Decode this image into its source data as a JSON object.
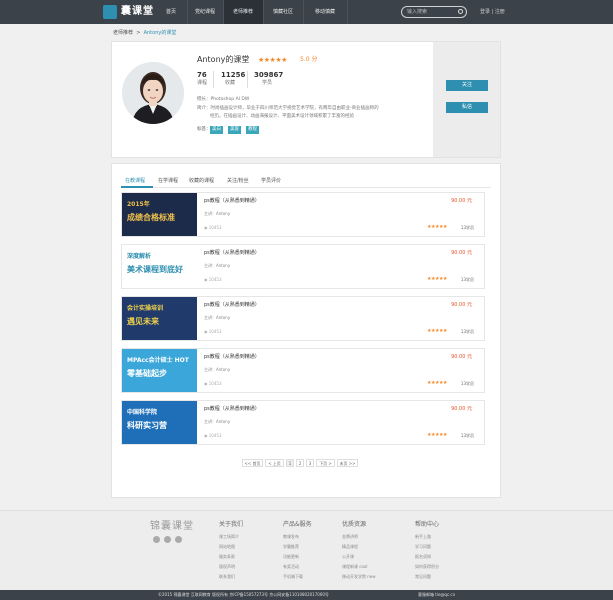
{
  "nav": {
    "logo": "囊课堂",
    "items": [
      "首页",
      "党纪课程",
      "老师推荐",
      "慎藏社区",
      "移动慎藏"
    ],
    "active_index": 2,
    "search_placeholder": "输入搜索",
    "login": "登录",
    "register": "注册"
  },
  "breadcrumb": {
    "root": "老师推荐",
    "sep": ">",
    "current": "Antony的课堂"
  },
  "profile": {
    "name": "Antony的课堂",
    "stars": "★★★★★",
    "score": "5.0 分",
    "stats": [
      {
        "value": "76",
        "label": "课程"
      },
      {
        "value": "11256",
        "label": "收藏"
      },
      {
        "value": "309867",
        "label": "学员"
      }
    ],
    "skills": "擅长：Photoshop   AI  DW",
    "intro1": "简介：时尚插画设计师，毕业于四川师范大学视觉艺术学院，有两年自由职业-商业插画师的",
    "intro2": "经历。在插画设计、动画海报设计、平面美术设计领域积累了丰富的经验",
    "tag_label": "标签：",
    "tags": [
      "美白",
      "美容",
      "教程"
    ],
    "follow": "关注",
    "message": "私信"
  },
  "tabs": [
    "在教课程",
    "在学课程",
    "收藏的课程",
    "关注/粉丝",
    "学员评价"
  ],
  "courses": [
    {
      "title": "ps教程（从熟悉到精通）",
      "price": "90.00 元",
      "teacher": "主讲：Antony",
      "views": "10453",
      "stars": "★★★★★",
      "students": "13学员",
      "thumb_text1": "2015年",
      "thumb_text2": "成绩合格标准"
    },
    {
      "title": "ps教程（从熟悉到精通）",
      "price": "90.00 元",
      "teacher": "主讲：Antony",
      "views": "10453",
      "stars": "★★★★★",
      "students": "13学员",
      "thumb_text1": "深度解析",
      "thumb_text2": "美术课程到底好"
    },
    {
      "title": "ps教程（从熟悉到精通）",
      "price": "90.00 元",
      "teacher": "主讲：Antony",
      "views": "10453",
      "stars": "★★★★★",
      "students": "13学员",
      "thumb_text1": "会计实操培训",
      "thumb_text2": "遇见未来"
    },
    {
      "title": "ps教程（从熟悉到精通）",
      "price": "90.00 元",
      "teacher": "主讲：Antony",
      "views": "10453",
      "stars": "★★★★★",
      "students": "13学员",
      "thumb_text1": "MPAcc会计硕士 HOT",
      "thumb_text2": "零基础起步"
    },
    {
      "title": "ps教程（从熟悉到精通）",
      "price": "90.00 元",
      "teacher": "主讲：Antony",
      "views": "10453",
      "stars": "★★★★★",
      "students": "13学员",
      "thumb_text1": "中国科学院",
      "thumb_text2": "科研实习营"
    }
  ],
  "pagination": [
    "<< 首页",
    "< 上页",
    "1",
    "2",
    "3",
    "下页 >",
    "末页 >>"
  ],
  "footer": {
    "logo": "锦囊课堂",
    "cols": [
      {
        "head": "关于我们",
        "links": [
          "课工场简介",
          "网站地图",
          "服务条款",
          "版权声明",
          "联系我们"
        ]
      },
      {
        "head": "产品&服务",
        "links": [
          "教课发布",
          "学霸推荐",
          "功能更新",
          "有奖活动",
          "手机端下载"
        ]
      },
      {
        "head": "优质资源",
        "links": [
          "金牌讲师",
          "精品课程",
          "公开课",
          "课程新课 cool",
          "移动开发学院 new"
        ]
      },
      {
        "head": "帮助中心",
        "links": [
          "新手上路",
          "学习问题",
          "报名须知",
          "如何获得积分",
          "常见问题"
        ]
      }
    ],
    "copyright": "©2015 锦囊课堂 互联网教育 版权所有 京ICP备15057273号 京公网安备11010802017060号",
    "contact": "客服邮箱  tie@qc.cn"
  }
}
